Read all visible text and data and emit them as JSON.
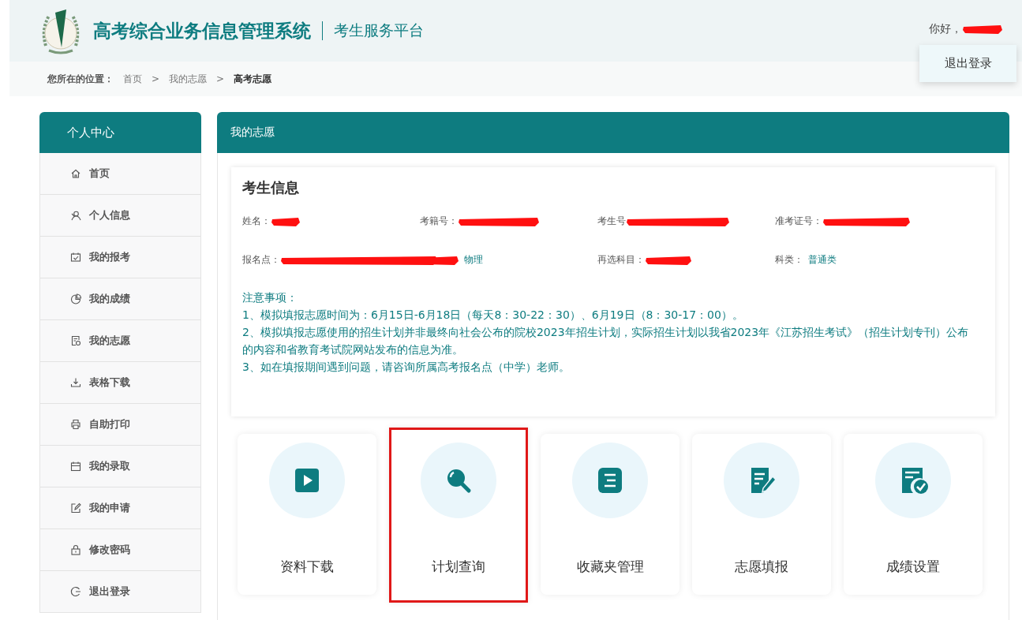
{
  "header": {
    "title": "高考综合业务信息管理系统",
    "subtitle": "考生服务平台",
    "greeting": "你好，",
    "greeting_redacted": true,
    "menu": {
      "items": [
        "退出登录"
      ]
    }
  },
  "breadcrumb": {
    "label": "您所在的位置：",
    "items": [
      {
        "text": "首页",
        "current": false
      },
      {
        "text": "我的志愿",
        "current": false
      },
      {
        "text": "高考志愿",
        "current": true
      }
    ],
    "separator": ">"
  },
  "sidebar": {
    "title": "个人中心",
    "items": [
      {
        "label": "首页"
      },
      {
        "label": "个人信息"
      },
      {
        "label": "我的报考"
      },
      {
        "label": "我的成绩"
      },
      {
        "label": "我的志愿"
      },
      {
        "label": "表格下载"
      },
      {
        "label": "自助打印"
      },
      {
        "label": "我的录取"
      },
      {
        "label": "我的申请"
      },
      {
        "label": "修改密码"
      },
      {
        "label": "退出登录"
      }
    ]
  },
  "panel": {
    "title": "我的志愿",
    "info": {
      "title": "考生信息",
      "rows": [
        [
          {
            "label": "姓名：",
            "redacted": true
          },
          {
            "label": "考籍号：",
            "redacted": true
          },
          {
            "label": "考生号",
            "redacted": true
          },
          {
            "label": "准考证号：",
            "redacted": true
          }
        ],
        [
          {
            "label": "报名点：",
            "redacted": true
          },
          {
            "redacted": true,
            "value": "物理"
          },
          {
            "label": "再选科目：",
            "redacted": true
          },
          {
            "label": "科类：",
            "value": "普通类"
          }
        ]
      ],
      "notes": [
        "注意事项：",
        "1、模拟填报志愿时间为：6月15日-6月18日（每天8：30-22：30）、6月19日（8：30-17：00）。",
        "2、模拟填报志愿使用的招生计划并非最终向社会公布的院校2023年招生计划，实际招生计划以我省2023年《江苏招生考试》（招生计划专刊）公布的内容和省教育考试院网站发布的信息为准。",
        "3、如在填报期间遇到问题，请咨询所属高考报名点（中学）老师。"
      ]
    },
    "cards": [
      {
        "label": "资料下载",
        "highlighted": false
      },
      {
        "label": "计划查询",
        "highlighted": true
      },
      {
        "label": "收藏夹管理",
        "highlighted": false
      },
      {
        "label": "志愿填报",
        "highlighted": false
      },
      {
        "label": "成绩设置",
        "highlighted": false
      }
    ]
  }
}
